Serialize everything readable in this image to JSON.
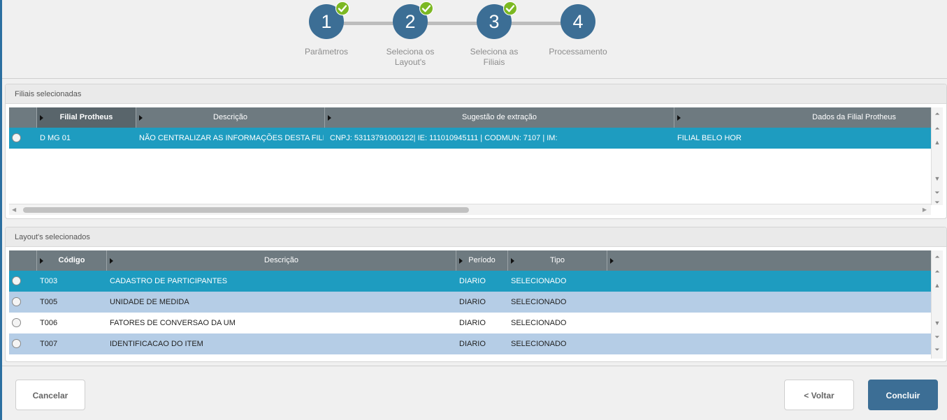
{
  "wizard": {
    "steps": [
      {
        "number": "1",
        "label": "Parâmetros",
        "done": true
      },
      {
        "number": "2",
        "label": "Seleciona os Layout's",
        "done": true
      },
      {
        "number": "3",
        "label": "Seleciona as Filiais",
        "done": true
      },
      {
        "number": "4",
        "label": "Processamento",
        "done": false
      }
    ]
  },
  "filiais": {
    "title": "Filiais selecionadas",
    "columns": [
      "Filial Protheus",
      "Descrição",
      "Sugestão de extração",
      "Dados da Filial Protheus"
    ],
    "rows": [
      {
        "filial": "D MG 01",
        "descricao": "NÃO CENTRALIZAR AS INFORMAÇÕES DESTA FILIAL",
        "sugestao": "CNPJ: 53113791000122| IE: 111010945111  | CODMUN: 7107   | IM:",
        "dados": "FILIAL BELO HOR"
      }
    ]
  },
  "layouts": {
    "title": "Layout's selecionados",
    "columns": [
      "Código",
      "Descrição",
      "Período",
      "Tipo"
    ],
    "rows": [
      {
        "codigo": "T003",
        "descricao": "CADASTRO DE PARTICIPANTES",
        "periodo": "DIARIO",
        "tipo": "SELECIONADO"
      },
      {
        "codigo": "T005",
        "descricao": "UNIDADE DE MEDIDA",
        "periodo": "DIARIO",
        "tipo": "SELECIONADO"
      },
      {
        "codigo": "T006",
        "descricao": "FATORES DE CONVERSAO DA UM",
        "periodo": "DIARIO",
        "tipo": "SELECIONADO"
      },
      {
        "codigo": "T007",
        "descricao": "IDENTIFICACAO DO ITEM",
        "periodo": "DIARIO",
        "tipo": "SELECIONADO"
      }
    ]
  },
  "buttons": {
    "cancel": "Cancelar",
    "back": "< Voltar",
    "finish": "Concluir"
  },
  "colors": {
    "step": "#3c6e95",
    "check": "#7cb823",
    "active_row": "#1e9cc0",
    "alt_row": "#b5cde6",
    "header": "#6e7a80"
  }
}
